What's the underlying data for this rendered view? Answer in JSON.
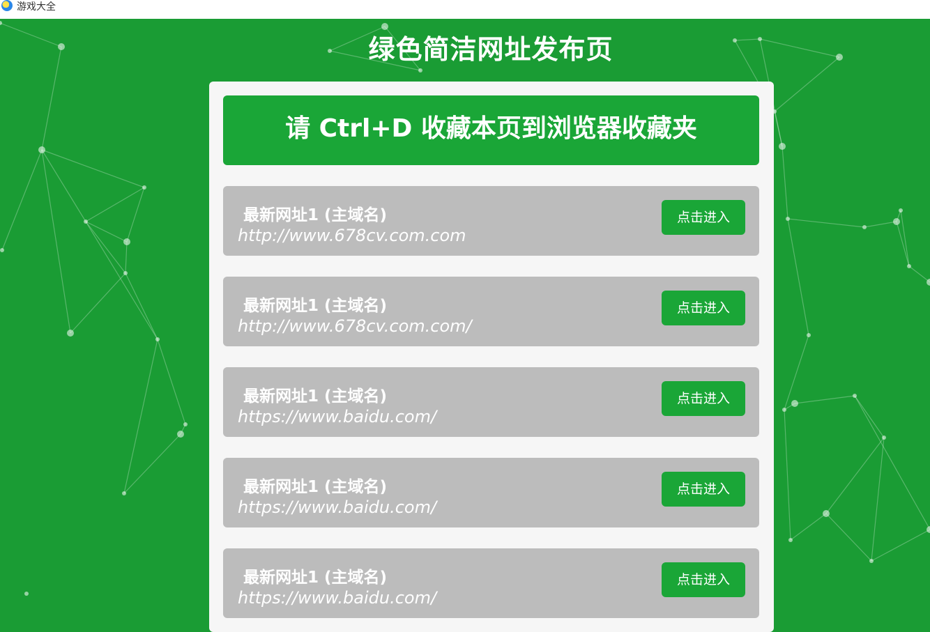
{
  "browser": {
    "tab_title": "游戏大全",
    "tab_icon": "browser-logo-icon"
  },
  "page": {
    "title": "绿色简洁网址发布页",
    "bookmark_notice": "请 Ctrl+D 收藏本页到浏览器收藏夹",
    "colors": {
      "background": "#1a9c34",
      "accent": "#1aa637",
      "card": "#bcbcbc",
      "panel": "#f6f6f6"
    }
  },
  "links": [
    {
      "label": "最新网址1 (主域名)",
      "url": "http://www.678cv.com.com",
      "button": "点击进入"
    },
    {
      "label": "最新网址1 (主域名)",
      "url": "http://www.678cv.com.com/",
      "button": "点击进入"
    },
    {
      "label": "最新网址1 (主域名)",
      "url": "https://www.baidu.com/",
      "button": "点击进入"
    },
    {
      "label": "最新网址1 (主域名)",
      "url": "https://www.baidu.com/",
      "button": "点击进入"
    },
    {
      "label": "最新网址1 (主域名)",
      "url": "https://www.baidu.com/",
      "button": "点击进入"
    }
  ]
}
